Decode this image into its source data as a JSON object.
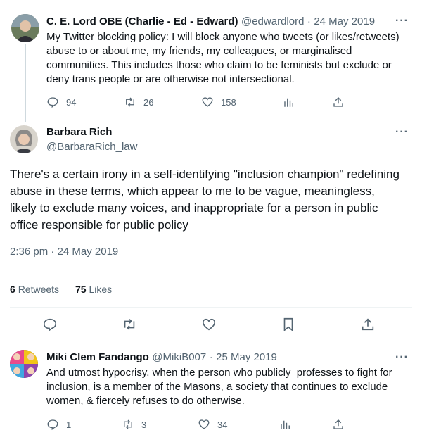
{
  "tweet1": {
    "author_name": "C. E. Lord OBE (Charlie - Ed - Edward)",
    "handle": "@edwardlord",
    "separator": "·",
    "date": "24 May 2019",
    "text": "My Twitter blocking policy: I will block anyone who tweets (or likes/retweets) abuse to or about me, my friends, my colleagues, or marginalised communities. This includes those who claim to be feminists but exclude or deny trans people or are otherwise not intersectional.",
    "replies": "94",
    "retweets": "26",
    "likes": "158"
  },
  "tweet2": {
    "author_name": "Barbara Rich",
    "handle": "@BarbaraRich_law",
    "text": "There's a certain irony in a self-identifying \"inclusion champion\" redefining abuse in these terms, which appear to me to be vague, meaningless, likely to exclude many voices, and inappropriate for a person in public office responsible for public policy",
    "timestamp": "2:36 pm · 24 May 2019",
    "retweet_count": "6",
    "retweet_label": "Retweets",
    "like_count": "75",
    "like_label": "Likes"
  },
  "tweet3": {
    "author_name": "Miki Clem Fandango",
    "handle": "@MikiB007",
    "separator": "·",
    "date": "25 May 2019",
    "text": "And utmost hypocrisy, when the person who publicly  professes to fight for inclusion, is a member of the Masons, a society that continues to exclude women, & fiercely refuses to do otherwise.",
    "replies": "1",
    "retweets": "3",
    "likes": "34"
  },
  "more_glyph": "···",
  "colors": {
    "text": "#0f1419",
    "secondary": "#536471",
    "divider": "#eff3f4",
    "thread_line": "#cfd9de"
  },
  "icons": [
    "reply-icon",
    "retweet-icon",
    "like-icon",
    "views-icon",
    "share-icon",
    "bookmark-icon",
    "more-icon"
  ]
}
